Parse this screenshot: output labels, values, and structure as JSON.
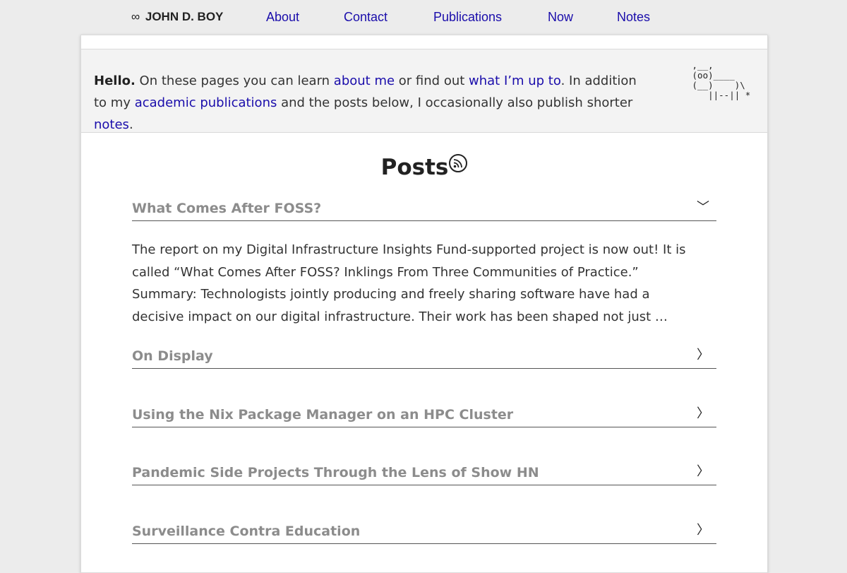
{
  "nav": {
    "brand_symbol": "∞",
    "brand_name": "JOHN D. BOY",
    "links": [
      "About",
      "Contact",
      "Publications",
      "Now",
      "Notes"
    ]
  },
  "intro": {
    "hello": "Hello.",
    "t1": " On these pages you can learn ",
    "link_about": "about me",
    "t2": " or find out ",
    "link_now": "what I’m up to",
    "t3": ". In addition to my ",
    "link_pubs": "academic publications",
    "t4": " and the posts below, I occasionally also publish shorter ",
    "link_notes": "notes",
    "t5": ".",
    "ascii_art": " ,__,\n (oo)____\n (__)    )\\\n    ||--|| *"
  },
  "posts_heading": "Posts",
  "posts": [
    {
      "title": "What Comes After FOSS?",
      "chevron": "﹀",
      "expanded": true,
      "summary": "The report on my Digital Infrastructure Insights Fund-supported project is now out! It is called “What Comes After FOSS? Inklings From Three Communities of Practice.” Summary: Technologists jointly producing and freely sharing software have had a decisive impact on our digital infrastructure. Their work has been shaped not just …"
    },
    {
      "title": "On Display",
      "chevron": "〉",
      "expanded": false
    },
    {
      "title": "Using the Nix Package Manager on an HPC Cluster",
      "chevron": "〉",
      "expanded": false
    },
    {
      "title": "Pandemic Side Projects Through the Lens of Show HN",
      "chevron": "〉",
      "expanded": false
    },
    {
      "title": "Surveillance Contra Education",
      "chevron": "〉",
      "expanded": false
    }
  ],
  "icons": {
    "rss": "rss-feed-icon"
  },
  "colors": {
    "link": "#1a0dab",
    "muted_title": "#8c8c8c",
    "background": "#ececec"
  }
}
